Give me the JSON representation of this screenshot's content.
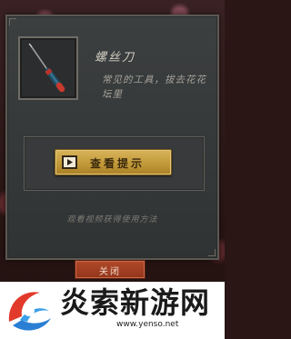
{
  "item": {
    "name": "螺丝刀",
    "description": "常见的工具，拔去花花坛里",
    "icon": "screwdriver-icon"
  },
  "hint": {
    "button_label": "查看提示",
    "button_icon": "video-play-icon",
    "video_note": "观看视频获得使用方法"
  },
  "dialog": {
    "close_label": "关闭"
  },
  "watermark": {
    "site_name": "炎索新游网",
    "url": "www.yenso.net"
  },
  "colors": {
    "hint_button": "#c39a3a",
    "close_button": "#93351c",
    "panel": "#383a3b"
  }
}
